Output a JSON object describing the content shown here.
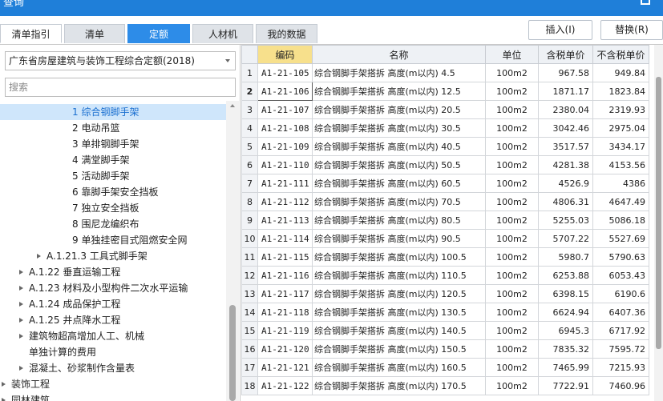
{
  "window": {
    "title": "查询"
  },
  "tabs": [
    {
      "label": "清单指引"
    },
    {
      "label": "清单"
    },
    {
      "label": "定额"
    },
    {
      "label": "人材机"
    },
    {
      "label": "我的数据"
    }
  ],
  "active_tab": "定额",
  "toolbar": {
    "insert_label": "插入(I)",
    "replace_label": "替换(R)"
  },
  "left": {
    "library_select": "广东省房屋建筑与装饰工程综合定额(2018)",
    "search_placeholder": "搜索",
    "tree": [
      {
        "label": "1 综合钢脚手架",
        "level": 4,
        "selected": true,
        "expandable": false
      },
      {
        "label": "2 电动吊篮",
        "level": 4,
        "selected": false,
        "expandable": false
      },
      {
        "label": "3 单排钢脚手架",
        "level": 4,
        "selected": false,
        "expandable": false
      },
      {
        "label": "4 满堂脚手架",
        "level": 4,
        "selected": false,
        "expandable": false
      },
      {
        "label": "5 活动脚手架",
        "level": 4,
        "selected": false,
        "expandable": false
      },
      {
        "label": "6 靠脚手架安全挡板",
        "level": 4,
        "selected": false,
        "expandable": false
      },
      {
        "label": "7 独立安全挡板",
        "level": 4,
        "selected": false,
        "expandable": false
      },
      {
        "label": "8 围尼龙编织布",
        "level": 4,
        "selected": false,
        "expandable": false
      },
      {
        "label": "9 单独挂密目式阻燃安全网",
        "level": 4,
        "selected": false,
        "expandable": false
      },
      {
        "label": "A.1.21.3 工具式脚手架",
        "level": 3,
        "selected": false,
        "expandable": true
      },
      {
        "label": "A.1.22 垂直运输工程",
        "level": 2,
        "selected": false,
        "expandable": true
      },
      {
        "label": "A.1.23 材料及小型构件二次水平运输",
        "level": 2,
        "selected": false,
        "expandable": true
      },
      {
        "label": "A.1.24 成品保护工程",
        "level": 2,
        "selected": false,
        "expandable": true
      },
      {
        "label": "A.1.25 井点降水工程",
        "level": 2,
        "selected": false,
        "expandable": true
      },
      {
        "label": "建筑物超高增加人工、机械",
        "level": 2,
        "selected": false,
        "expandable": true
      },
      {
        "label": "单独计算的费用",
        "level": 2,
        "selected": false,
        "expandable": false
      },
      {
        "label": "混凝土、砂浆制作含量表",
        "level": 2,
        "selected": false,
        "expandable": true
      },
      {
        "label": "装饰工程",
        "level": 1,
        "selected": false,
        "expandable": true
      },
      {
        "label": "园林建筑",
        "level": 1,
        "selected": false,
        "expandable": true
      }
    ]
  },
  "grid": {
    "headers": {
      "code": "编码",
      "name": "名称",
      "unit": "单位",
      "tax_incl": "含税单价",
      "tax_excl": "不含税单价"
    },
    "rows": [
      {
        "n": "1",
        "code": "A1-21-105",
        "name": "综合钢脚手架搭拆 高度(m以内) 4.5",
        "unit": "100m2",
        "tax_incl": "967.58",
        "tax_excl": "949.84"
      },
      {
        "n": "2",
        "code": "A1-21-106",
        "name": "综合钢脚手架搭拆 高度(m以内) 12.5",
        "unit": "100m2",
        "tax_incl": "1871.17",
        "tax_excl": "1823.84"
      },
      {
        "n": "3",
        "code": "A1-21-107",
        "name": "综合钢脚手架搭拆 高度(m以内) 20.5",
        "unit": "100m2",
        "tax_incl": "2380.04",
        "tax_excl": "2319.93"
      },
      {
        "n": "4",
        "code": "A1-21-108",
        "name": "综合钢脚手架搭拆 高度(m以内) 30.5",
        "unit": "100m2",
        "tax_incl": "3042.46",
        "tax_excl": "2975.04"
      },
      {
        "n": "5",
        "code": "A1-21-109",
        "name": "综合钢脚手架搭拆 高度(m以内) 40.5",
        "unit": "100m2",
        "tax_incl": "3517.57",
        "tax_excl": "3434.17"
      },
      {
        "n": "6",
        "code": "A1-21-110",
        "name": "综合钢脚手架搭拆 高度(m以内) 50.5",
        "unit": "100m2",
        "tax_incl": "4281.38",
        "tax_excl": "4153.56"
      },
      {
        "n": "7",
        "code": "A1-21-111",
        "name": "综合钢脚手架搭拆 高度(m以内) 60.5",
        "unit": "100m2",
        "tax_incl": "4526.9",
        "tax_excl": "4386"
      },
      {
        "n": "8",
        "code": "A1-21-112",
        "name": "综合钢脚手架搭拆 高度(m以内) 70.5",
        "unit": "100m2",
        "tax_incl": "4806.31",
        "tax_excl": "4647.49"
      },
      {
        "n": "9",
        "code": "A1-21-113",
        "name": "综合钢脚手架搭拆 高度(m以内) 80.5",
        "unit": "100m2",
        "tax_incl": "5255.03",
        "tax_excl": "5086.18"
      },
      {
        "n": "10",
        "code": "A1-21-114",
        "name": "综合钢脚手架搭拆 高度(m以内) 90.5",
        "unit": "100m2",
        "tax_incl": "5707.22",
        "tax_excl": "5527.69"
      },
      {
        "n": "11",
        "code": "A1-21-115",
        "name": "综合钢脚手架搭拆 高度(m以内) 100.5",
        "unit": "100m2",
        "tax_incl": "5980.7",
        "tax_excl": "5790.63"
      },
      {
        "n": "12",
        "code": "A1-21-116",
        "name": "综合钢脚手架搭拆 高度(m以内) 110.5",
        "unit": "100m2",
        "tax_incl": "6253.88",
        "tax_excl": "6053.43"
      },
      {
        "n": "13",
        "code": "A1-21-117",
        "name": "综合钢脚手架搭拆 高度(m以内) 120.5",
        "unit": "100m2",
        "tax_incl": "6398.15",
        "tax_excl": "6190.6"
      },
      {
        "n": "14",
        "code": "A1-21-118",
        "name": "综合钢脚手架搭拆 高度(m以内) 130.5",
        "unit": "100m2",
        "tax_incl": "6624.94",
        "tax_excl": "6407.36"
      },
      {
        "n": "15",
        "code": "A1-21-119",
        "name": "综合钢脚手架搭拆 高度(m以内) 140.5",
        "unit": "100m2",
        "tax_incl": "6945.3",
        "tax_excl": "6717.92"
      },
      {
        "n": "16",
        "code": "A1-21-120",
        "name": "综合钢脚手架搭拆 高度(m以内) 150.5",
        "unit": "100m2",
        "tax_incl": "7835.32",
        "tax_excl": "7595.72"
      },
      {
        "n": "17",
        "code": "A1-21-121",
        "name": "综合钢脚手架搭拆 高度(m以内) 160.5",
        "unit": "100m2",
        "tax_incl": "7465.99",
        "tax_excl": "7215.93"
      },
      {
        "n": "18",
        "code": "A1-21-122",
        "name": "综合钢脚手架搭拆 高度(m以内) 170.5",
        "unit": "100m2",
        "tax_incl": "7722.91",
        "tax_excl": "7460.96"
      }
    ],
    "current_row": "2"
  },
  "colors": {
    "accent": "#2d8ce8",
    "titlebar": "#1f7fd9",
    "header_highlight": "#f7e08c",
    "tree_selected": "#cfe6fb"
  }
}
